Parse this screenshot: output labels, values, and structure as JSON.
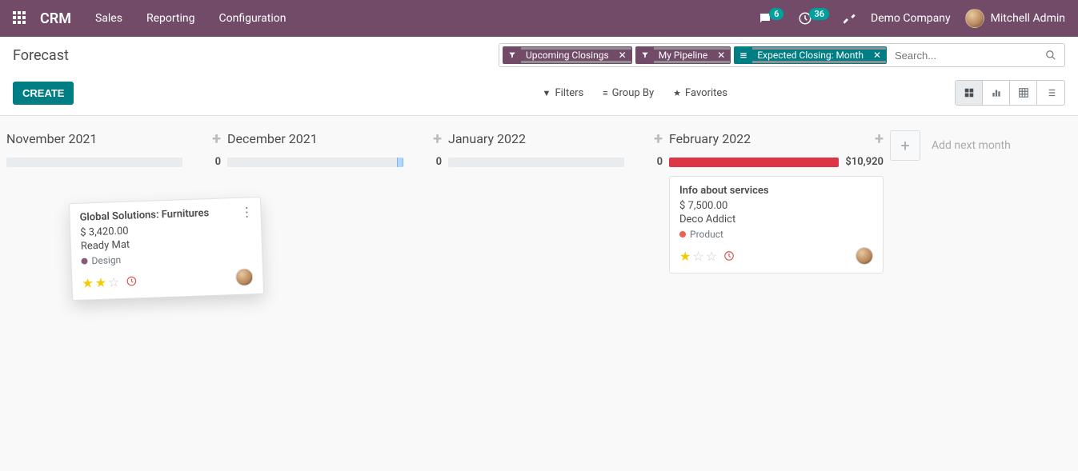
{
  "navbar": {
    "brand": "CRM",
    "links": [
      "Sales",
      "Reporting",
      "Configuration"
    ],
    "messages_count": "6",
    "activities_count": "36",
    "company": "Demo Company",
    "user": "Mitchell Admin"
  },
  "breadcrumb": "Forecast",
  "search": {
    "facets": [
      {
        "type": "filter",
        "label": "Upcoming Closings"
      },
      {
        "type": "filter",
        "label": "My Pipeline"
      },
      {
        "type": "groupby",
        "label": "Expected Closing: Month"
      }
    ],
    "placeholder": "Search..."
  },
  "toolbar": {
    "create": "CREATE",
    "filters": "Filters",
    "groupby": "Group By",
    "favorites": "Favorites"
  },
  "columns": [
    {
      "title": "November 2021",
      "total": "0",
      "fill_pct": 0,
      "fill_color": "#e9ecef"
    },
    {
      "title": "December 2021",
      "total": "0",
      "fill_pct": 0,
      "fill_color": "#e9ecef",
      "drop": true
    },
    {
      "title": "January 2022",
      "total": "0",
      "fill_pct": 0,
      "fill_color": "#e9ecef"
    },
    {
      "title": "February 2022",
      "total": "$10,920",
      "fill_pct": 100,
      "fill_color": "#dc3545"
    }
  ],
  "add_month_label": "Add next month",
  "floating_card": {
    "title": "Global Solutions: Furnitures",
    "amount": "$ 3,420.00",
    "customer": "Ready Mat",
    "tag": "Design",
    "tag_color": "#875A7B",
    "stars": 2
  },
  "feb_card": {
    "title": "Info about services",
    "amount": "$ 7,500.00",
    "customer": "Deco Addict",
    "tag": "Product",
    "tag_color": "#f06050",
    "stars": 1
  }
}
